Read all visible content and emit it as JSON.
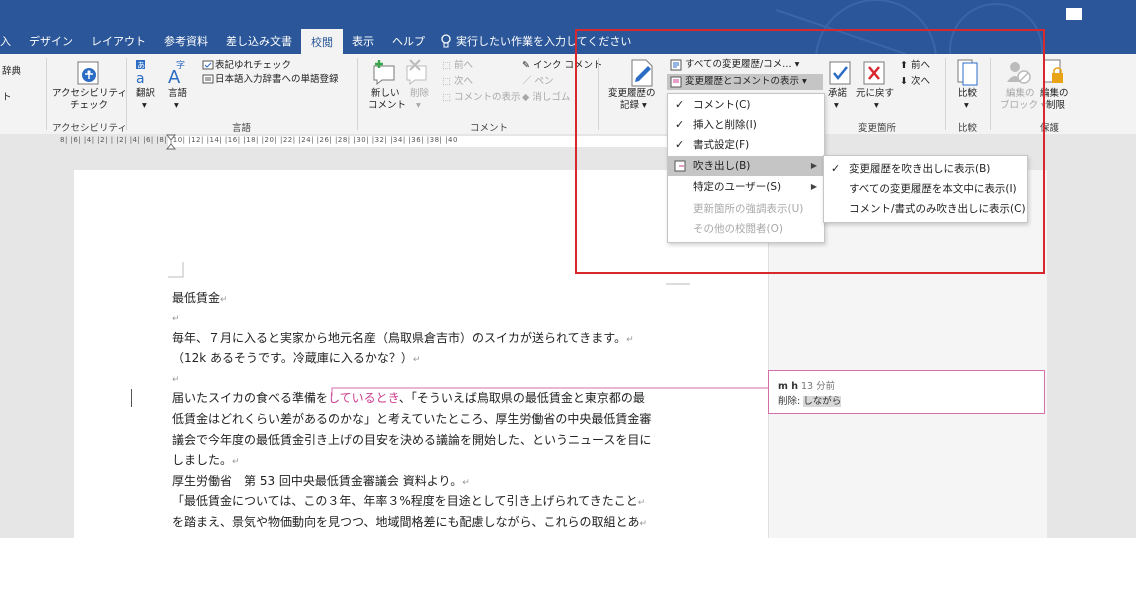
{
  "tabs": {
    "items": [
      "入",
      "デザイン",
      "レイアウト",
      "参考資料",
      "差し込み文書",
      "校閲",
      "表示",
      "ヘルプ"
    ],
    "active": "校閲",
    "tell_me": "実行したい作業を入力してください"
  },
  "ribbon": {
    "left_edge": {
      "top": "辞典",
      "bottom": "ト"
    },
    "accessibility": {
      "button": "アクセシビリティ",
      "button2": "チェック",
      "group": "アクセシビリティ"
    },
    "language": {
      "translate": "翻訳",
      "language": "言語",
      "hyoki": "表記ゆれチェック",
      "dict": "日本語入力辞書への単語登録",
      "group": "言語"
    },
    "comments": {
      "new1": "新しい",
      "new2": "コメント",
      "delete": "削除",
      "prev": "前へ",
      "next": "次へ",
      "show": "コメントの表示",
      "ink": "インク コメント",
      "pen": "ペン",
      "eraser": "消しゴム",
      "group": "コメント"
    },
    "tracking": {
      "record1": "変更履歴の",
      "record2": "記録",
      "all_markup": "すべての変更履歴/コメ…",
      "show_markup": "変更履歴とコメントの表示"
    },
    "changes": {
      "accept": "承諾",
      "reject": "元に戻す",
      "prev": "前へ",
      "next": "次へ",
      "group": "変更箇所"
    },
    "compare": {
      "button": "比較",
      "group": "比較"
    },
    "protect": {
      "block1": "編集の",
      "block2": "ブロック",
      "restrict1": "編集の",
      "restrict2": "制限",
      "group": "保護"
    }
  },
  "ruler": {
    "numbers": "8|  |6|  |4|  |2|  |  |2|  |4|  |6|  |8|  |10|  |12|  |14|  |16|  |18|  |20|  |22|  |24|  |26|  |28|  |30|  |32|  |34|  |36|  |38|  |40"
  },
  "document": {
    "title": "最低賃金",
    "p1": "毎年、７月に入ると実家から地元名産（鳥取県倉吉市）のスイカが送られてきます。",
    "p2": "（12k あるそうです。冷蔵庫に入るかな？）",
    "p3_pre": "届いたスイカの食べる準備を",
    "p3_del": "しているとき",
    "p3_post": "、「そういえば鳥取県の最低賃金と東京都の最",
    "p4": "低賃金はどれくらい差があるのかな」と考えていたところ、厚生労働省の中央最低賃金審",
    "p5": "議会で今年度の最低賃金引き上げの目安を決める議論を開始した、というニュースを目に",
    "p6": "しました。",
    "p7": "厚生労働省　第 53 回中央最低賃金審議会 資料より。",
    "p8": "「最低賃金については、この３年、年率３%程度を目途として引き上げられてきたこと",
    "p9": "を踏まえ、景気や物価動向を見つつ、地域間格差にも配慮しながら、これらの取組とあ"
  },
  "balloon": {
    "author": "m h",
    "time": "13 分前",
    "label": "削除:",
    "text": "しながら"
  },
  "menu1": {
    "items": [
      {
        "label": "コメント(C)",
        "checked": true,
        "submenu": false,
        "disabled": false
      },
      {
        "label": "挿入と削除(I)",
        "checked": true,
        "submenu": false,
        "disabled": false
      },
      {
        "label": "書式設定(F)",
        "checked": true,
        "submenu": false,
        "disabled": false
      },
      {
        "label": "吹き出し(B)",
        "checked": false,
        "submenu": true,
        "disabled": false
      },
      {
        "label": "特定のユーザー(S)",
        "checked": false,
        "submenu": true,
        "disabled": false
      },
      {
        "label": "更新箇所の強調表示(U)",
        "checked": false,
        "submenu": false,
        "disabled": true
      },
      {
        "label": "その他の校閲者(O)",
        "checked": false,
        "submenu": false,
        "disabled": true
      }
    ]
  },
  "menu2": {
    "items": [
      {
        "label": "変更履歴を吹き出しに表示(B)",
        "checked": true
      },
      {
        "label": "すべての変更履歴を本文中に表示(I)",
        "checked": false
      },
      {
        "label": "コメント/書式のみ吹き出しに表示(C)",
        "checked": false
      }
    ]
  },
  "colors": {
    "word_blue": "#2b579a",
    "deletion": "#cc3d8f",
    "annotation_red": "#d9272e"
  }
}
